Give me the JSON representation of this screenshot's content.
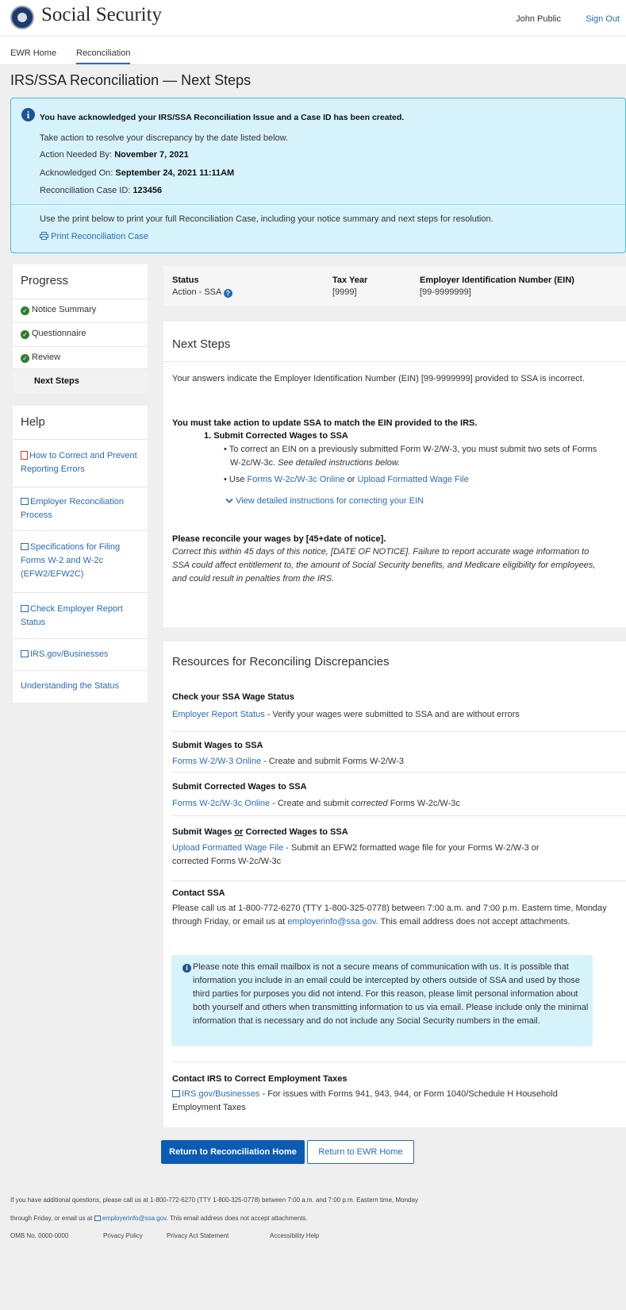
{
  "header": {
    "brand": "Social Security",
    "user_name": "John Public",
    "sign_out": "Sign Out"
  },
  "nav": {
    "tabs": [
      "EWR Home",
      "Reconciliation"
    ],
    "active": "Reconciliation"
  },
  "page_title": "IRS/SSA Reconciliation — Next Steps",
  "ack": {
    "headline": "You have acknowledged your IRS/SSA Reconciliation Issue and a Case ID has been created.",
    "instruction": "Take action to resolve your discrepancy by the date listed below.",
    "action_label": "Action Needed By:",
    "action_value": "November 7, 2021",
    "ack_label": "Acknowledged On:",
    "ack_value": "September 24, 2021 11:11AM",
    "case_label": "Reconciliation Case ID:",
    "case_value": "123456",
    "print_text": "Use the print below to print your full Reconciliation Case, including your notice summary and next steps for resolution.",
    "print_link": "Print Reconciliation Case"
  },
  "progress": {
    "title": "Progress",
    "items": [
      {
        "label": "Notice Summary",
        "done": true
      },
      {
        "label": "Questionnaire",
        "done": true
      },
      {
        "label": "Review",
        "done": true
      },
      {
        "label": "Next Steps",
        "done": false
      }
    ]
  },
  "help": {
    "title": "Help",
    "items": [
      {
        "label": "How to Correct and Prevent Reporting Errors",
        "icon": "pdf-icon"
      },
      {
        "label": "Employer Reconciliation Process",
        "icon": "external-link-icon"
      },
      {
        "label": "Specifications for Filing Forms W-2 and W-2c (EFW2/EFW2C)",
        "icon": "external-link-icon"
      },
      {
        "label": "Check Employer Report Status",
        "icon": "external-link-icon"
      },
      {
        "label": "IRS.gov/Businesses",
        "icon": "external-link-icon"
      },
      {
        "label": "Understanding the Status",
        "icon": ""
      }
    ]
  },
  "status_bar": {
    "status_label": "Status",
    "status_value": "Action - SSA",
    "year_label": "Tax Year",
    "year_value": "[9999]",
    "ein_label": "Employer Identification Number (EIN)",
    "ein_value": "[99-9999999]"
  },
  "next_steps": {
    "title": "Next Steps",
    "intro": "Your answers indicate the Employer Identification Number (EIN) [99-9999999] provided to SSA is incorrect.",
    "must_act": "You must take action to update SSA to match the EIN provided to the IRS.",
    "step1": "1.  Submit Corrected Wages to SSA",
    "bullet1_a": "To correct an EIN on a previously submitted Form W-2/W-3, you must submit two sets of Forms W-2c/W-3c.",
    "bullet1_b": "See detailed instructions below.",
    "bullet2_pre": "Use",
    "bullet2_link1": "Forms  W-2c/W-3c Online",
    "bullet2_or": "or",
    "bullet2_link2": "Upload Formatted Wage File",
    "toggle": "View detailed instructions for correcting your EIN",
    "reconcile_title": "Please reconcile your wages by [45+date of notice].",
    "reconcile_text": "Correct this within 45 days of this notice, [DATE OF NOTICE].  Failure to report accurate wage information to SSA could affect entitlement to, the amount of Social Security benefits, and Medicare eligibility for employees, and could result in penalties from the IRS."
  },
  "resources": {
    "title": "Resources for Reconciling Discrepancies",
    "sections": [
      {
        "title": "Check your SSA Wage Status",
        "link": "Employer Report Status",
        "text": " - Verify your wages were submitted to SSA and are without errors"
      },
      {
        "title": "Submit Wages to SSA",
        "link": "Forms  W-2/W-3 Online",
        "text": " - Create and submit Forms W-2/W-3"
      },
      {
        "title": "Submit Corrected Wages to SSA",
        "link": "Forms  W-2c/W-3c Online",
        "text_pre": " - Create and submit ",
        "text_em": "corrected",
        "text_post": " Forms W-2c/W-3c"
      },
      {
        "title_a": "Submit Wages ",
        "title_or": "or",
        "title_b": " Corrected Wages to SSA",
        "link": "Upload Formatted Wage File",
        "text": " - Submit an EFW2 formatted wage file for your Forms W-2/W-3 or corrected Forms W-2c/W-3c"
      }
    ],
    "contact_title": "Contact SSA",
    "contact_pre": "Please call us at 1-800-772-6270 (TTY 1-800-325-0778) between 7:00 a.m. and 7:00 p.m. Eastern time, Monday through Friday, or email us at ",
    "contact_email": "employerinfo@ssa.gov",
    "contact_post": ". This email address does not accept attachments.",
    "note": "Please note this email mailbox is not a secure means of communication with us. It is possible that information you include in an email could be intercepted by others outside of SSA and used by those third parties for purposes you did not intend. For this reason, please limit personal information about both yourself and others when transmitting information to us via email.  Please include only the minimal information that is necessary and do not include any Social Security numbers in the email.",
    "irs_title": "Contact IRS to Correct Employment Taxes",
    "irs_link": "IRS.gov/Businesses",
    "irs_text": " - For issues with Forms 941, 943, 944, or Form 1040/Schedule H Household Employment Taxes"
  },
  "buttons": {
    "primary": "Return to Reconciliation Home",
    "secondary": "Return to EWR Home"
  },
  "footer": {
    "line1": "If you have additional questions, please call us at 1-800-772-6270 (TTY 1-800-325-0778) between 7:00 a.m. and 7:00 p.m. Eastern time, Monday",
    "line2_pre": "through Friday, or email us at ",
    "email": "employerinfo@ssa.gov",
    "line2_post": ". This email address does not accept attachments.",
    "omb": "OMB No. 0000-0000",
    "links": [
      "Privacy Policy",
      "Privacy Act Statement",
      "Accessibility Help"
    ]
  }
}
